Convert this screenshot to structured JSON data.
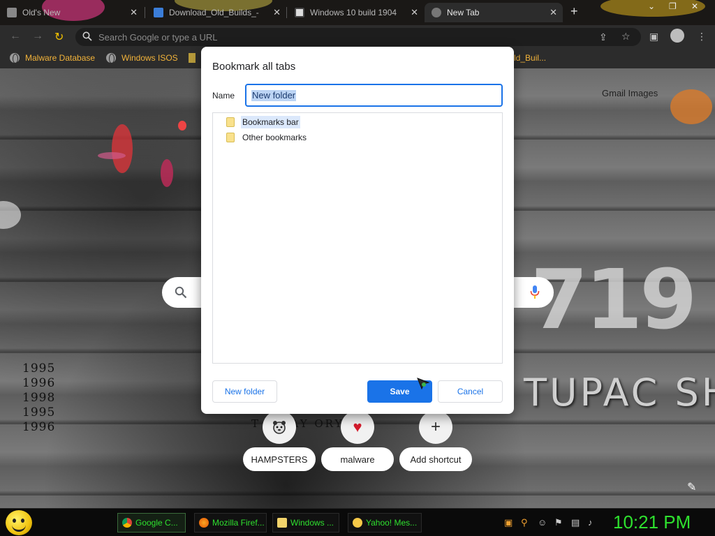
{
  "browser": {
    "tabs": [
      {
        "title": "Old's New",
        "active": false
      },
      {
        "title": "Download_Old_Builds_-",
        "active": false
      },
      {
        "title": "Windows 10 build 1904",
        "active": false
      },
      {
        "title": "New Tab",
        "active": true
      }
    ],
    "omnibox_placeholder": "Search Google or type a URL",
    "bookmarks": [
      {
        "label": "Malware Database"
      },
      {
        "label": "Windows ISOS"
      },
      {
        "label": "ld_Buil..."
      }
    ]
  },
  "ntp": {
    "gmail_images": "Gmail   Images",
    "years": [
      "1995",
      "1996",
      "1998",
      "1995",
      "1996"
    ],
    "big_number": "719",
    "tupac_text": "TUPAC SH",
    "today_text": "T    Y DAY      ORY",
    "shortcuts": [
      {
        "label": "HAMPSTERS",
        "icon": "hamster-icon"
      },
      {
        "label": "malware",
        "icon": "heart-icon"
      },
      {
        "label": "Add shortcut",
        "icon": "plus-icon"
      }
    ]
  },
  "dialog": {
    "title": "Bookmark all tabs",
    "name_label": "Name",
    "name_value": "New folder",
    "folders": [
      {
        "label": "Bookmarks bar",
        "selected": true
      },
      {
        "label": "Other bookmarks",
        "selected": false
      }
    ],
    "new_folder_button": "New folder",
    "save_button": "Save",
    "cancel_button": "Cancel"
  },
  "taskbar": {
    "items": [
      {
        "label": "Google C...",
        "icon": "chrome-icon"
      },
      {
        "label": "Mozilla Firef...",
        "icon": "firefox-icon"
      },
      {
        "label": "Windows ...",
        "icon": "folder-icon"
      },
      {
        "label": "Yahoo! Mes...",
        "icon": "yahoo-messenger-icon"
      }
    ],
    "clock": "10:21 PM"
  },
  "colors": {
    "accent": "#1a73e8",
    "bookmark_text": "#f2b33a",
    "taskbar_text": "#2ee02e"
  }
}
